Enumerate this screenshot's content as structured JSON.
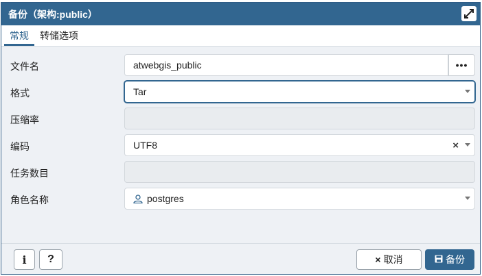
{
  "dialog": {
    "title": "备份（架构:public）"
  },
  "tabs": [
    {
      "label": "常规",
      "active": true
    },
    {
      "label": "转储选项",
      "active": false
    }
  ],
  "form": {
    "filename": {
      "label": "文件名",
      "value": "atwebgis_public",
      "browse_label": "•••"
    },
    "format": {
      "label": "格式",
      "value": "Tar"
    },
    "compression": {
      "label": "压缩率",
      "value": ""
    },
    "encoding": {
      "label": "编码",
      "value": "UTF8",
      "clear": "×"
    },
    "jobs": {
      "label": "任务数目",
      "value": ""
    },
    "role": {
      "label": "角色名称",
      "value": "postgres"
    }
  },
  "footer": {
    "info_label": "i",
    "help_label": "?",
    "cancel_label": "取消",
    "cancel_icon": "×",
    "backup_label": "备份"
  },
  "colors": {
    "accent": "#326690",
    "body_bg": "#eef1f5"
  }
}
